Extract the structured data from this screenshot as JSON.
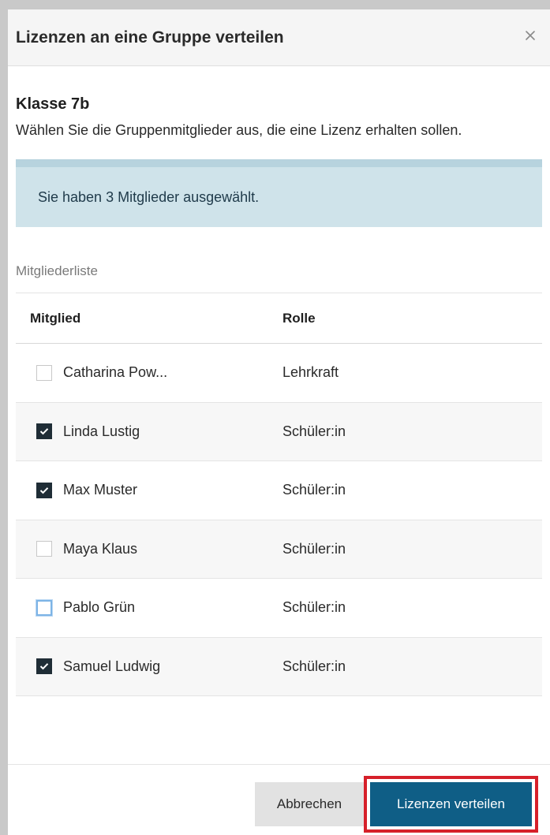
{
  "dialog": {
    "title": "Lizenzen an eine Gruppe verteilen",
    "close_icon": "close-icon"
  },
  "group": {
    "name": "Klasse 7b",
    "description": "Wählen Sie die Gruppenmitglieder aus, die eine Lizenz erhalten sollen."
  },
  "info": {
    "text": "Sie haben 3 Mitglieder ausgewählt."
  },
  "member_list": {
    "label": "Mitgliederliste",
    "headers": {
      "member": "Mitglied",
      "role": "Rolle"
    },
    "rows": [
      {
        "name": "Catharina Pow...",
        "role": "Lehrkraft",
        "checked": false
      },
      {
        "name": "Linda Lustig",
        "role": "Schüler:in",
        "checked": true
      },
      {
        "name": "Max Muster",
        "role": "Schüler:in",
        "checked": true
      },
      {
        "name": "Maya Klaus",
        "role": "Schüler:in",
        "checked": false
      },
      {
        "name": "Pablo Grün",
        "role": "Schüler:in",
        "checked": false,
        "focused": true
      },
      {
        "name": "Samuel Ludwig",
        "role": "Schüler:in",
        "checked": true
      }
    ]
  },
  "footer": {
    "cancel_label": "Abbrechen",
    "submit_label": "Lizenzen verteilen"
  },
  "colors": {
    "primary": "#0f5e86",
    "info_bg": "#cfe3ea",
    "highlight": "#d6202a"
  }
}
